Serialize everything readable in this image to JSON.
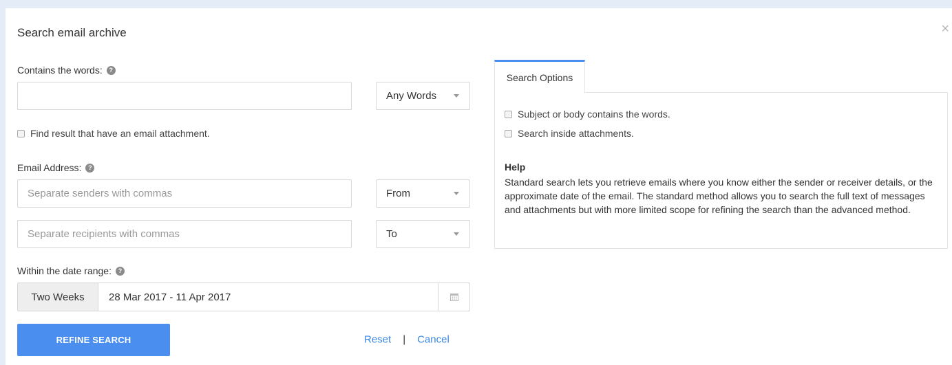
{
  "dialog": {
    "title": "Search email archive",
    "close_label": "×"
  },
  "words": {
    "label": "Contains the words:",
    "help_icon": "?",
    "value": "",
    "placeholder": "",
    "match_select": "Any Words"
  },
  "attachment_filter": {
    "label": "Find result that have an email attachment.",
    "checked": false
  },
  "email": {
    "label": "Email Address:",
    "help_icon": "?",
    "senders_placeholder": "Separate senders with commas",
    "senders_select": "From",
    "recipients_placeholder": "Separate recipients with commas",
    "recipients_select": "To"
  },
  "date": {
    "label": "Within the date range:",
    "help_icon": "?",
    "preset": "Two Weeks",
    "range": "28 Mar 2017 - 11 Apr 2017"
  },
  "actions": {
    "refine_label": "REFINE SEARCH",
    "reset_label": "Reset",
    "separator": "|",
    "cancel_label": "Cancel"
  },
  "options": {
    "tab_label": "Search Options",
    "checkbox_subject": "Subject or body contains the words.",
    "checkbox_attachments": "Search inside attachments.",
    "help_title": "Help",
    "help_text": "Standard search lets you retrieve emails where you know either the sender or receiver details, or the approximate date of the email. The standard method allows you to search the full text of messages and attachments but with more limited scope for refining the search than the advanced method."
  },
  "colors": {
    "accent": "#4a8ef0",
    "link": "#3b87e0",
    "background": "#e3ecf7"
  },
  "icons": {
    "help": "question-circle-icon",
    "close": "close-icon",
    "calendar": "calendar-icon",
    "dropdown": "chevron-down-icon"
  }
}
